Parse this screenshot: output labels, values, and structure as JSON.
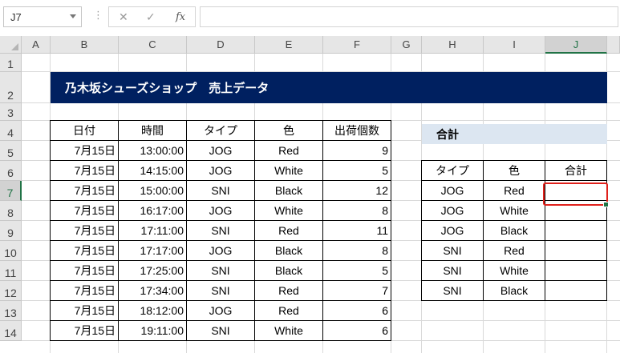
{
  "formula_bar": {
    "name_box": "J7",
    "cancel_icon": "✕",
    "enter_icon": "✓",
    "fx_label": "fx",
    "formula_value": ""
  },
  "columns": [
    "A",
    "B",
    "C",
    "D",
    "E",
    "F",
    "G",
    "H",
    "I",
    "J"
  ],
  "rows": [
    "1",
    "2",
    "3",
    "4",
    "5",
    "6",
    "7",
    "8",
    "9",
    "10",
    "11",
    "12",
    "13",
    "14"
  ],
  "selected_cell": "J7",
  "title": "乃木坂シューズショップ　売上データ",
  "sales_table": {
    "headers": [
      "日付",
      "時間",
      "タイプ",
      "色",
      "出荷個数"
    ],
    "rows": [
      [
        "7月15日",
        "13:00:00",
        "JOG",
        "Red",
        "9"
      ],
      [
        "7月15日",
        "14:15:00",
        "JOG",
        "White",
        "5"
      ],
      [
        "7月15日",
        "15:00:00",
        "SNI",
        "Black",
        "12"
      ],
      [
        "7月15日",
        "16:17:00",
        "JOG",
        "White",
        "8"
      ],
      [
        "7月15日",
        "17:11:00",
        "SNI",
        "Red",
        "11"
      ],
      [
        "7月15日",
        "17:17:00",
        "JOG",
        "Black",
        "8"
      ],
      [
        "7月15日",
        "17:25:00",
        "SNI",
        "Black",
        "5"
      ],
      [
        "7月15日",
        "17:34:00",
        "SNI",
        "Red",
        "7"
      ],
      [
        "7月15日",
        "18:12:00",
        "JOG",
        "Red",
        "6"
      ],
      [
        "7月15日",
        "19:11:00",
        "SNI",
        "White",
        "6"
      ]
    ]
  },
  "summary": {
    "label": "合計",
    "headers": [
      "タイプ",
      "色",
      "合計"
    ],
    "rows": [
      [
        "JOG",
        "Red",
        ""
      ],
      [
        "JOG",
        "White",
        ""
      ],
      [
        "JOG",
        "Black",
        ""
      ],
      [
        "SNI",
        "Red",
        ""
      ],
      [
        "SNI",
        "White",
        ""
      ],
      [
        "SNI",
        "Black",
        ""
      ]
    ]
  },
  "colors": {
    "title_bg": "#002060",
    "summary_label_bg": "#dce6f1",
    "selection_border": "#e0211b",
    "excel_green": "#217346"
  }
}
